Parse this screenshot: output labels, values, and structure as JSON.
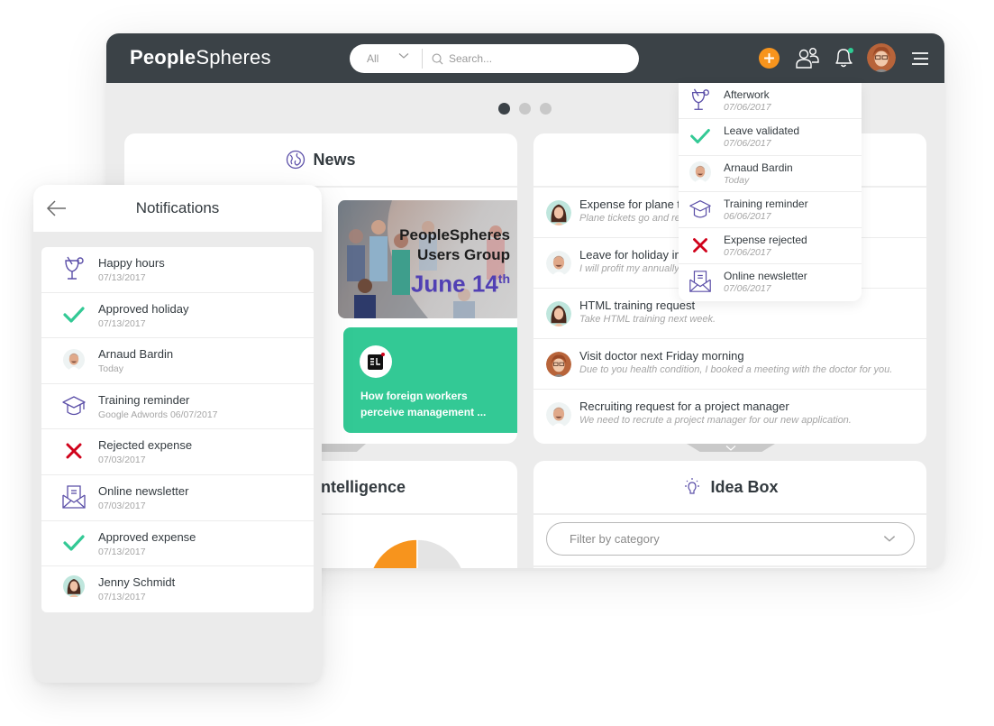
{
  "app": {
    "logo_bold": "People",
    "logo_light": "Spheres"
  },
  "search": {
    "scope": "All",
    "placeholder": "Search..."
  },
  "colors": {
    "topbar": "#3b4247",
    "accent_orange": "#f7941d",
    "success_green": "#33c995",
    "error_red": "#d0021b",
    "icon_purple": "#5b4fa8",
    "notification_dot": "#2ecc94"
  },
  "header_icons": [
    "plus-icon",
    "users-icon",
    "bell-icon",
    "user-avatar",
    "hamburger-menu-icon"
  ],
  "carousel": {
    "pages": 3,
    "active_index": 0
  },
  "news": {
    "title": "News",
    "icon": "globe-icon",
    "banner": {
      "line1": "PeopleSpheres",
      "line2": "Users Group",
      "date": "June 14",
      "date_suffix": "th"
    },
    "article": {
      "logo": "EL",
      "title": "How foreign workers perceive management ..."
    }
  },
  "tasks": [
    {
      "title": "Expense for plane tickets",
      "subtitle": "Plane tickets go and return",
      "avatar": "woman-dark-hair"
    },
    {
      "title": "Leave for holiday in August",
      "subtitle": "I will profit my annually leave",
      "avatar": "man-grey-hair"
    },
    {
      "title": "HTML training request",
      "subtitle": "Take HTML training next week.",
      "avatar": "woman-dark-hair"
    },
    {
      "title": "Visit doctor next Friday morning",
      "subtitle": "Due to you health condition, I booked a meeting with the doctor for you.",
      "avatar": "woman-glasses"
    },
    {
      "title": "Recruiting request for a project manager",
      "subtitle": "We need to recrute a project manager for our new application.",
      "avatar": "man-grey-hair"
    }
  ],
  "business_intelligence": {
    "title": "Business Intelligence",
    "visible_title": "s Intelligence",
    "chart_data": {
      "type": "pie",
      "values": [
        25,
        75
      ],
      "colors": [
        "#f7941d",
        "#e4e4e4"
      ]
    }
  },
  "idea_box": {
    "title": "Idea Box",
    "filter_placeholder": "Filter by category"
  },
  "dropdown_notifications": [
    {
      "title": "Afterwork",
      "date": "07/06/2017",
      "icon": "cocktail-icon"
    },
    {
      "title": "Leave validated",
      "date": "07/06/2017",
      "icon": "check-icon"
    },
    {
      "title": "Arnaud Bardin",
      "date": "Today",
      "icon": "avatar"
    },
    {
      "title": "Training reminder",
      "date": "06/06/2017",
      "icon": "graduation-cap-icon"
    },
    {
      "title": "Expense rejected",
      "date": "07/06/2017",
      "icon": "cross-icon"
    },
    {
      "title": "Online newsletter",
      "date": "07/06/2017",
      "icon": "envelope-icon"
    }
  ],
  "mobile": {
    "title": "Notifications",
    "items": [
      {
        "label": "Happy hours",
        "date": "07/13/2017",
        "icon": "cocktail-icon"
      },
      {
        "label": "Approved holiday",
        "date": "07/13/2017",
        "icon": "check-icon"
      },
      {
        "label": "Arnaud Bardin",
        "date": "Today",
        "icon": "avatar"
      },
      {
        "label": "Training reminder",
        "date": "Google Adwords 06/07/2017",
        "icon": "graduation-cap-icon"
      },
      {
        "label": "Rejected expense",
        "date": "07/03/2017",
        "icon": "cross-icon"
      },
      {
        "label": "Online newsletter",
        "date": "07/03/2017",
        "icon": "envelope-icon"
      },
      {
        "label": "Approved expense",
        "date": "07/13/2017",
        "icon": "check-icon"
      },
      {
        "label": "Jenny Schmidt",
        "date": "07/13/2017",
        "icon": "avatar"
      }
    ]
  }
}
